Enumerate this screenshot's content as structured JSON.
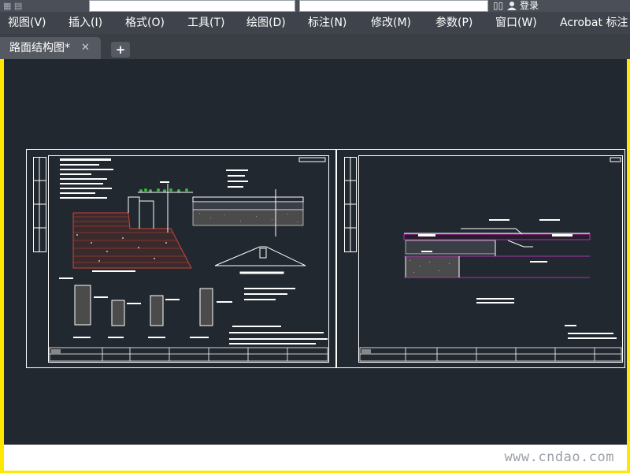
{
  "menu": {
    "items": [
      {
        "label": "视图(V)"
      },
      {
        "label": "插入(I)"
      },
      {
        "label": "格式(O)"
      },
      {
        "label": "工具(T)"
      },
      {
        "label": "绘图(D)"
      },
      {
        "label": "标注(N)"
      },
      {
        "label": "修改(M)"
      },
      {
        "label": "参数(P)"
      },
      {
        "label": "窗口(W)"
      },
      {
        "label": "Acrobat 标注"
      }
    ]
  },
  "top": {
    "login_label": "登录"
  },
  "tabs": {
    "active": {
      "title": "路面结构图*",
      "close_glyph": "✕"
    },
    "add_glyph": "+"
  },
  "watermark": {
    "text": "www.cndao.com"
  },
  "colors": {
    "canvas": "#212830",
    "frame": "#ffffff",
    "menu_bg": "#3f444c",
    "tab_bg": "#555a62",
    "magenta_layer": "#b030b0",
    "red_layer": "#c8463c",
    "green_layer": "#3cb43c",
    "border": "#ffe800"
  }
}
